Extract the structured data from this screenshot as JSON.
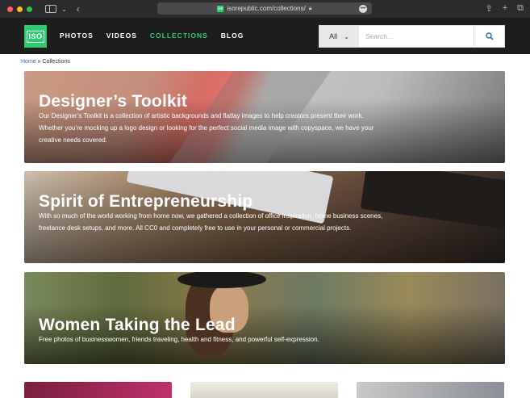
{
  "browser": {
    "url": "isorepublic.com/collections/",
    "traffic_colors": [
      "#ff5f57",
      "#febc2e",
      "#28c840"
    ]
  },
  "header": {
    "logo_text": "ISO",
    "nav": [
      {
        "label": "PHOTOS",
        "active": false
      },
      {
        "label": "VIDEOS",
        "active": false
      },
      {
        "label": "COLLECTIONS",
        "active": true
      },
      {
        "label": "BLOG",
        "active": false
      }
    ],
    "search": {
      "category": "All",
      "placeholder": "Search..."
    },
    "accent_color": "#2ecc71"
  },
  "breadcrumb": {
    "home": "Home",
    "separator": "»",
    "current": "Collections"
  },
  "collections": [
    {
      "title": "Designer’s Toolkit",
      "description": "Our Designer’s Toolkit is a collection of artistic backgrounds and flatlay images to help creators present their work. Whether you’re mocking up a logo design or looking for the perfect social media image with copyspace, we have your creative needs covered."
    },
    {
      "title": "Spirit of Entrepreneurship",
      "description": "With so much of the world working from home now, we gathered a collection of office inspiration, home business scenes, freelance desk setups, and more. All CC0 and completely free to use in your personal or commercial projects."
    },
    {
      "title": "Women Taking the Lead",
      "description": "Free photos of businesswomen, friends traveling, health and fitness, and powerful self-expression."
    }
  ]
}
